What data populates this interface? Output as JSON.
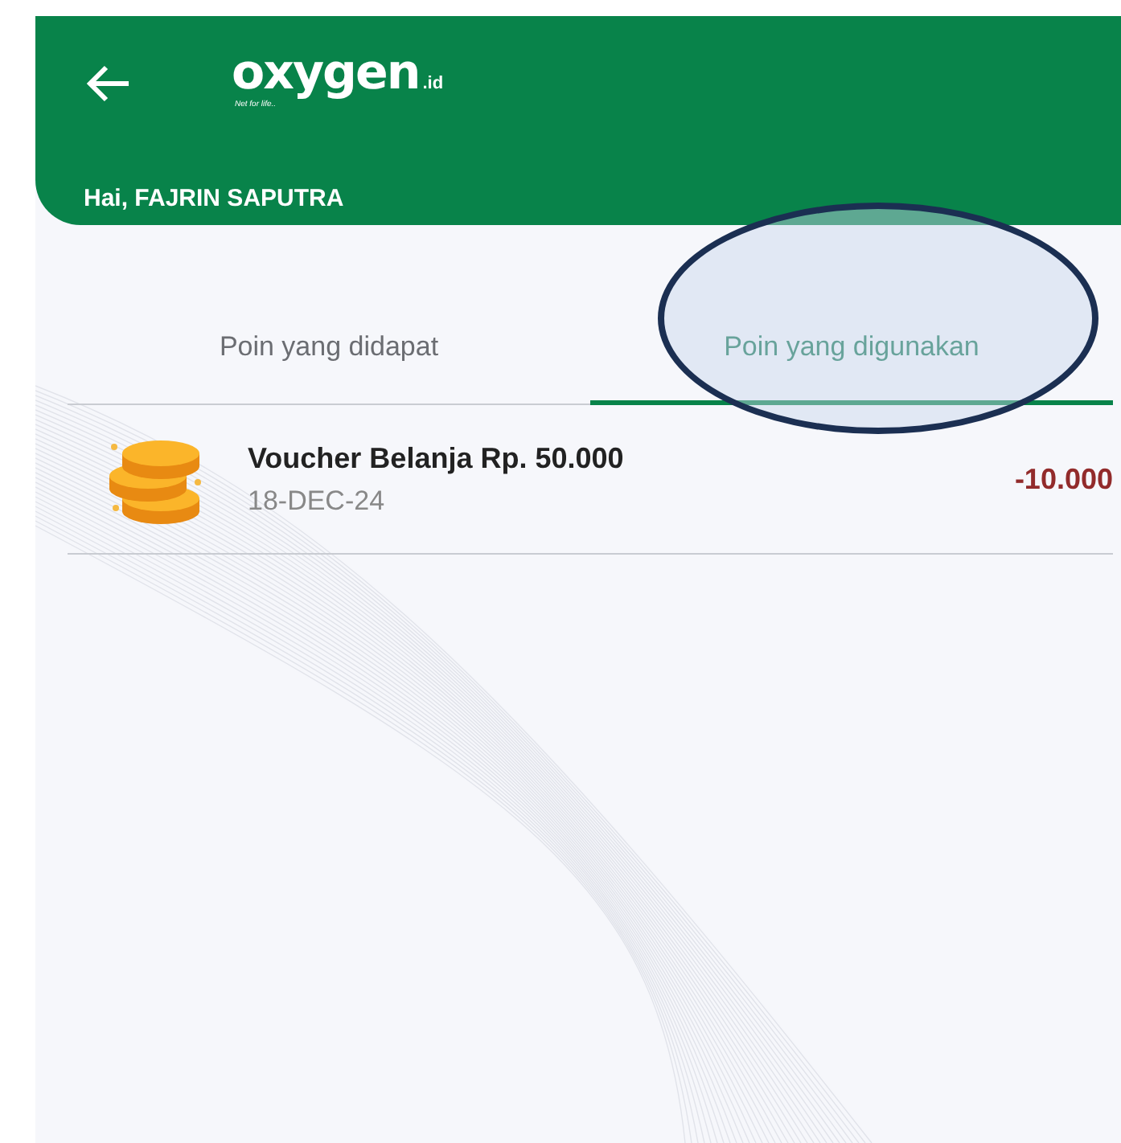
{
  "header": {
    "logo": {
      "wordmark": "oxygen",
      "suffix": ".id",
      "tagline": "Net for life.."
    },
    "greeting": "Hai, FAJRIN SAPUTRA"
  },
  "tabs": [
    {
      "label": "Poin yang didapat",
      "selected": false
    },
    {
      "label": "Poin yang digunakan",
      "selected": true
    }
  ],
  "transactions": [
    {
      "title": "Voucher Belanja Rp. 50.000",
      "date": "18-DEC-24",
      "points": "-10.000"
    }
  ]
}
